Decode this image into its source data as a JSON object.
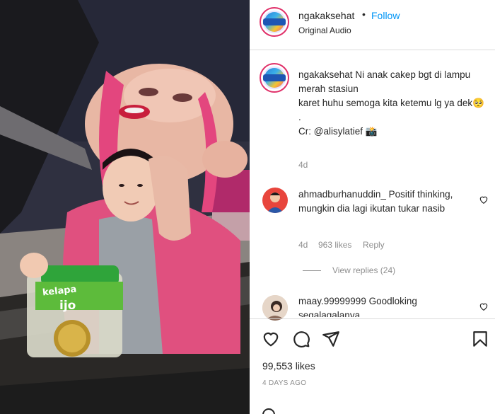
{
  "post": {
    "username": "ngakaksehat",
    "dot": "•",
    "follow_label": "Follow",
    "audio": "Original Audio",
    "caption_username": "ngakaksehat",
    "caption_text_line1": "Ni anak cakep bgt di lampu merah stasiun",
    "caption_text_line2": "karet huhu semoga kita ketemu lg ya dek🥺",
    "caption_dot": ".",
    "caption_credit": "Cr: @alisylatief 📸",
    "caption_time": "4d",
    "likes": "99,553 likes",
    "ago": "4 DAYS AGO"
  },
  "comments": [
    {
      "username": "ahmadburhanuddin_",
      "text": "Positif thinking, mungkin dia lagi ikutan tukar nasib",
      "time": "4d",
      "likes": "963 likes",
      "reply_label": "Reply",
      "view_replies": "View replies (24)"
    },
    {
      "username": "maay.99999999",
      "text": "Goodloking segalagalanya"
    }
  ],
  "media": {
    "jar_label": "kelapa",
    "jar_label2": "ijo"
  },
  "icons": [
    "heart-icon",
    "comment-icon",
    "share-icon",
    "bookmark-icon"
  ],
  "colors": {
    "follow": "#0095f6",
    "meta": "#8e8e8e",
    "text": "#262626"
  }
}
